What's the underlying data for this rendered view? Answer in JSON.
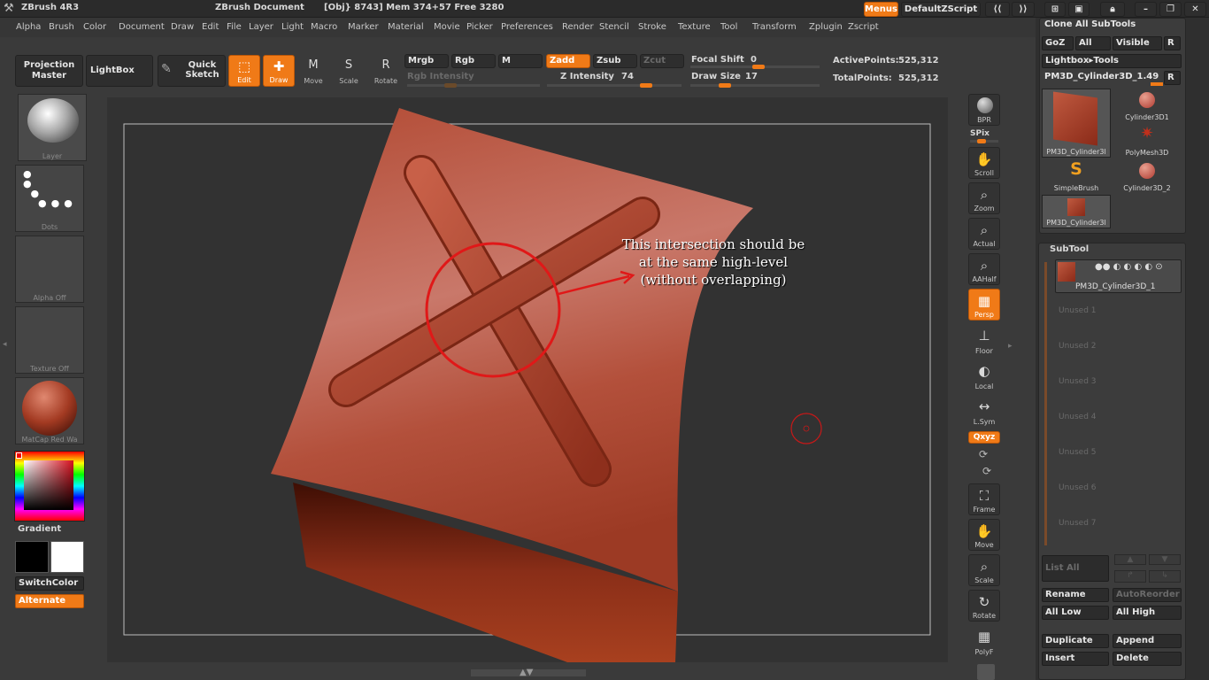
{
  "app": {
    "title": "ZBrush 4R3",
    "document": "ZBrush Document",
    "status": "[Obj} 8743] Mem 374+57  Free 3280"
  },
  "titlebar_right": {
    "menus_label": "Menus",
    "script_label": "DefaultZScript"
  },
  "menus": [
    "Alpha",
    "Brush",
    "Color",
    "Document",
    "Draw",
    "Edit",
    "File",
    "Layer",
    "Light",
    "Macro",
    "Marker",
    "Material",
    "Movie",
    "Picker",
    "Preferences",
    "Render",
    "Stencil",
    "Stroke",
    "Texture",
    "Tool",
    "Transform",
    "Zplugin",
    "Zscript"
  ],
  "toolbar": {
    "projection_master": "Projection Master",
    "lightbox": "LightBox",
    "quick_sketch": "Quick Sketch",
    "edit": "Edit",
    "draw": "Draw",
    "move": "Move",
    "scale": "Scale",
    "rotate": "Rotate",
    "mrgb": "Mrgb",
    "rgb": "Rgb",
    "m": "M",
    "rgb_intensity": "Rgb  Intensity",
    "zadd": "Zadd",
    "zsub": "Zsub",
    "zcut": "Zcut",
    "z_intensity_label": "Z  Intensity",
    "z_intensity": "74",
    "z_intensity_level": 0.74,
    "focal_shift_label": "Focal  Shift",
    "focal_shift": "0",
    "draw_size_label": "Draw  Size",
    "draw_size": "17",
    "active_points_label": "ActivePoints:",
    "active_points": "525,312",
    "total_points_label": "TotalPoints:",
    "total_points": "525,312"
  },
  "left_shelf": {
    "brush": "Layer",
    "stroke": "Dots",
    "alpha": "Alpha  Off",
    "texture": "Texture  Off",
    "material": "MatCap  Red  Wa",
    "gradient": "Gradient",
    "switch_color": "SwitchColor",
    "alternate": "Alternate"
  },
  "right_shelf": {
    "bpr": "BPR",
    "spix": "SPix",
    "scroll": "Scroll",
    "zoom": "Zoom",
    "actual": "Actual",
    "aahalf": "AAHalf",
    "persp": "Persp",
    "floor": "Floor",
    "local": "Local",
    "lsym": "L.Sym",
    "xyz": "Qxyz",
    "frame": "Frame",
    "move": "Move",
    "scale": "Scale",
    "rotate": "Rotate",
    "polyf": "PolyF"
  },
  "annotation": {
    "line1": "This intersection should be",
    "line2": "at the same high-level",
    "line3": "(without overlapping)"
  },
  "tool_panel": {
    "clone_all": "Clone  All  SubTools",
    "goz": "GoZ",
    "all": "All",
    "visible": "Visible",
    "r": "R",
    "lightbox_tools": "Lightbox▸Tools",
    "current_tool": "PM3D_Cylinder3D_1.",
    "current_tool_num": "49",
    "thumbs": [
      {
        "label": "PM3D_Cylinder3l"
      },
      {
        "label": "Cylinder3D1"
      },
      {
        "label": "PolyMesh3D"
      },
      {
        "label": "SimpleBrush"
      },
      {
        "label": "Cylinder3D_2"
      },
      {
        "label": "PM3D_Cylinder3l"
      }
    ]
  },
  "subtool": {
    "title": "SubTool",
    "active": "PM3D_Cylinder3D_1",
    "unused": [
      "Unused  1",
      "Unused  2",
      "Unused  3",
      "Unused  4",
      "Unused  5",
      "Unused  6",
      "Unused  7"
    ],
    "list_all": "List  All",
    "rename": "Rename",
    "auto_reorder": "AutoReorder",
    "all_low": "All  Low",
    "all_high": "All  High",
    "duplicate": "Duplicate",
    "append": "Append",
    "insert": "Insert",
    "delete": "Delete"
  },
  "colors": {
    "accent": "#f07a17",
    "mesh": "#a9442e",
    "annotation": "#e01818"
  }
}
